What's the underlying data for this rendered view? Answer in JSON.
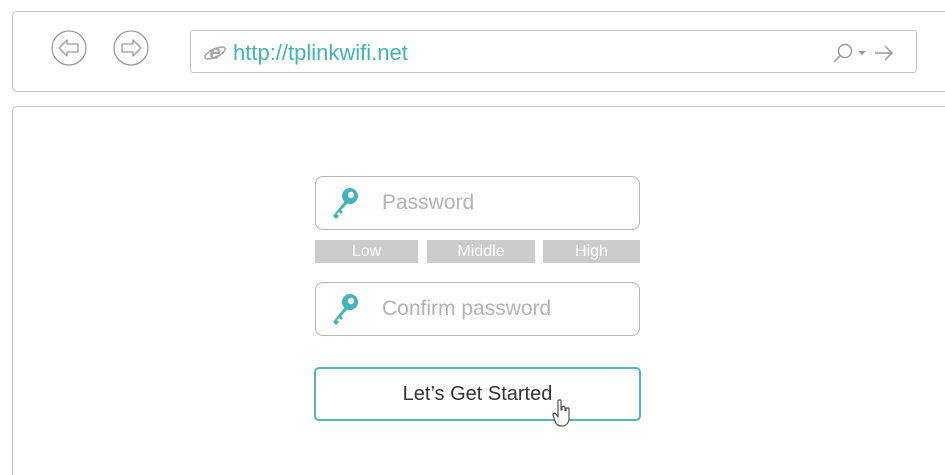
{
  "browser": {
    "url": "http://tplinkwifi.net",
    "icons": {
      "back": "back-arrow-circle-icon",
      "forward": "forward-arrow-circle-icon",
      "browser": "internet-explorer-icon",
      "search": "search-icon",
      "dropdown": "chevron-down-icon",
      "go": "arrow-right-icon"
    }
  },
  "form": {
    "password_placeholder": "Password",
    "confirm_placeholder": "Confirm password",
    "strength": {
      "low": "Low",
      "middle": "Middle",
      "high": "High"
    },
    "submit_label": "Let’s Get Started",
    "key_icon": "key-icon"
  },
  "colors": {
    "accent": "#41b3ba",
    "border": "#c4c4c4",
    "strength_bar": "#cccccc",
    "placeholder": "#b3b3b3"
  }
}
